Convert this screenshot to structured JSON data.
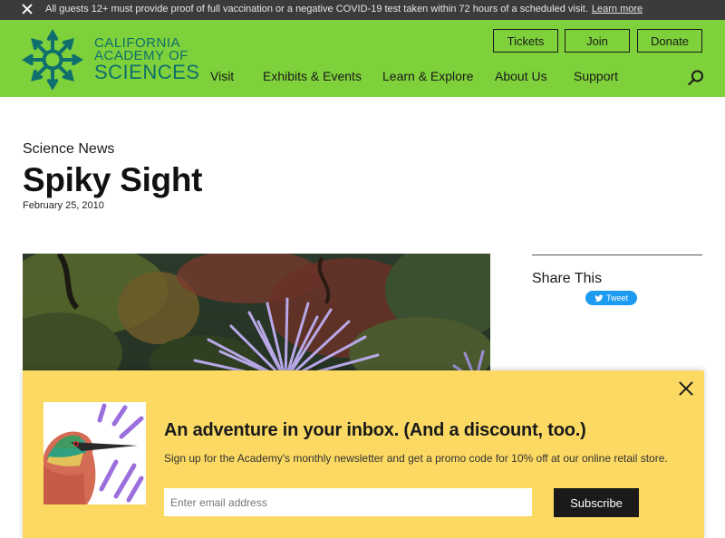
{
  "alert": {
    "message": "All guests 12+ must provide proof of full vaccination or a negative COVID-19 test taken within 72 hours of a scheduled visit.",
    "link": "Learn more"
  },
  "brand": {
    "line1": "CALIFORNIA",
    "line2": "ACADEMY OF",
    "line3": "SCIENCES",
    "color": "#0f6f6d",
    "header_color": "#7ed13a"
  },
  "top_buttons": {
    "tickets": "Tickets",
    "join": "Join",
    "donate": "Donate"
  },
  "nav": {
    "visit": "Visit",
    "exhibits": "Exhibits & Events",
    "learn": "Learn & Explore",
    "about": "About Us",
    "support": "Support"
  },
  "article": {
    "kicker": "Science News",
    "title": "Spiky Sight",
    "date": "February 25, 2010"
  },
  "share": {
    "title": "Share This",
    "tweet": "Tweet"
  },
  "newsletter": {
    "headline": "An adventure in your inbox. (And a discount, too.)",
    "subtext": "Sign up for the Academy's monthly newsletter and get a promo code for 10% off at our online retail store.",
    "email_placeholder": "Enter email address",
    "button": "Subscribe",
    "bg_color": "#fbd962"
  }
}
